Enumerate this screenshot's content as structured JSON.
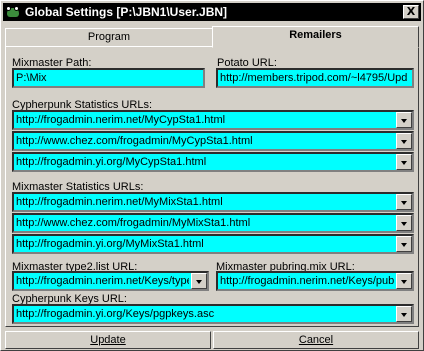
{
  "window": {
    "title": "Global Settings  [P:\\JBN1\\User.JBN]",
    "close_symbol": "X"
  },
  "tabs": [
    {
      "label": "Program",
      "active": false
    },
    {
      "label": "Remailers",
      "active": true
    }
  ],
  "mixmaster_path": {
    "label": "Mixmaster Path:",
    "value": "P:\\Mix"
  },
  "potato_url": {
    "label": "Potato URL:",
    "value": "http://members.tripod.com/~l4795/Upd"
  },
  "cypherpunk_stats": {
    "label": "Cypherpunk Statistics URLs:",
    "urls": [
      "http://frogadmin.nerim.net/MyCypSta1.html",
      "http://www.chez.com/frogadmin/MyCypSta1.html",
      "http://frogadmin.yi.org/MyCypSta1.html"
    ]
  },
  "mixmaster_stats": {
    "label": "Mixmaster Statistics URLs:",
    "urls": [
      "http://frogadmin.nerim.net/MyMixSta1.html",
      "http://www.chez.com/frogadmin/MyMixSta1.html",
      "http://frogadmin.yi.org/MyMixSta1.html"
    ]
  },
  "type2_list": {
    "label": "Mixmaster type2.list URL:",
    "value": "http://frogadmin.nerim.net/Keys/type"
  },
  "pubring_mix": {
    "label": "Mixmaster pubring.mix URL:",
    "value": "http://frogadmin.nerim.net/Keys/pub"
  },
  "cypherpunk_keys": {
    "label": "Cypherpunk Keys URL:",
    "value": "http://frogadmin.yi.org/Keys/pgpkeys.asc"
  },
  "buttons": {
    "update": "Update",
    "cancel": "Cancel"
  },
  "colors": {
    "field_bg": "#00ffff",
    "titlebar_bg": "#000000",
    "face": "#d4d0c8"
  }
}
